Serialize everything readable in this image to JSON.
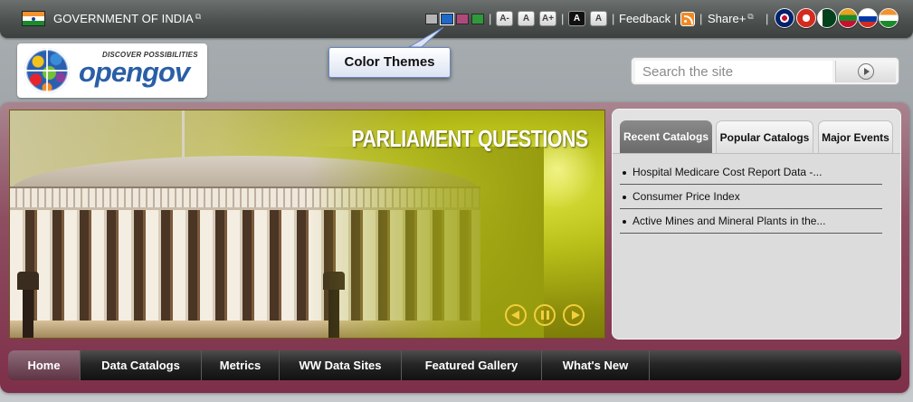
{
  "topbar": {
    "gov_label": "GOVERNMENT OF INDIA",
    "theme_colors": [
      "#b5b5b5",
      "#1d68c8",
      "#b0497a",
      "#2f9a3a"
    ],
    "font_sizes": [
      "A-",
      "A",
      "A+"
    ],
    "contrast": [
      "A",
      "A"
    ],
    "feedback": "Feedback",
    "share": "Share+",
    "languages": [
      "english-flag-icon",
      "swiss-cross-icon",
      "urdu-flag-icon",
      "telugu-flag-icon",
      "russian-flag-icon",
      "hindi-flag-icon"
    ]
  },
  "logo": {
    "tagline": "DISCOVER POSSIBILITIES",
    "name": "opengov"
  },
  "tooltip": {
    "text": "Color Themes"
  },
  "search": {
    "placeholder": "Search the site"
  },
  "banner": {
    "title": "PARLIAMENT QUESTIONS"
  },
  "catalogs": {
    "tabs": [
      "Recent Catalogs",
      "Popular Catalogs",
      "Major Events"
    ],
    "items": [
      "Hospital Medicare Cost Report Data -...",
      "Consumer Price Index",
      "Active Mines and Mineral Plants in the..."
    ]
  },
  "nav": [
    "Home",
    "Data Catalogs",
    "Metrics",
    "WW Data Sites",
    "Featured Gallery",
    "What's New"
  ]
}
